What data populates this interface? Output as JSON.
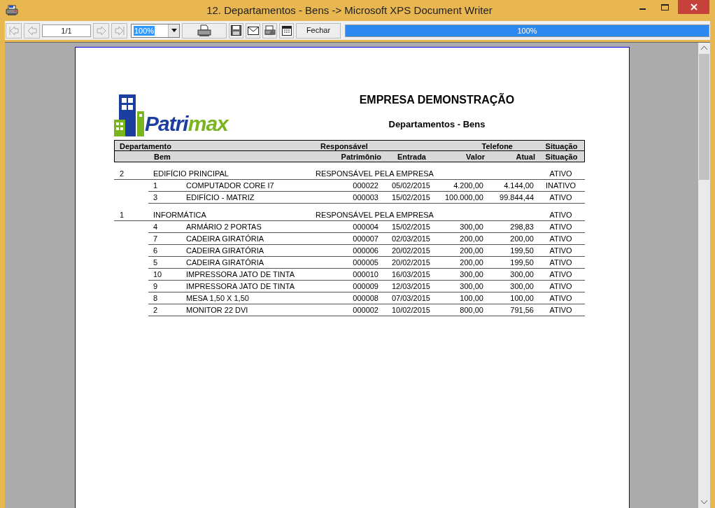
{
  "window": {
    "title": "12. Departamentos - Bens -> Microsoft XPS Document Writer"
  },
  "toolbar": {
    "page_field": "1/1",
    "zoom_value": "100%",
    "close_button": "Fechar",
    "progress": {
      "level": 1,
      "reading": "100%"
    }
  },
  "report": {
    "logo_text": [
      "Patri",
      "max"
    ],
    "company": "EMPRESA DEMONSTRAÇÃO",
    "title": "Departamentos - Bens",
    "header_row_1": [
      "Departamento",
      "Responsável",
      "Telefone",
      "Situação"
    ],
    "header_row_2": [
      "Bem",
      "Patrimônio",
      "Entrada",
      "Valor",
      "Atual",
      "Situação"
    ],
    "departments": [
      {
        "code": "2",
        "name": "EDIFÍCIO PRINCIPAL",
        "responsible": "RESPONSÁVEL PELA EMPRESA",
        "status": "ATIVO",
        "items": [
          {
            "code": "1",
            "name": "COMPUTADOR CORE I7",
            "asset": "000022",
            "date": "05/02/2015",
            "value": "4.200,00",
            "current": "4.144,00",
            "status": "INATIVO"
          },
          {
            "code": "3",
            "name": "EDIFÍCIO - MATRIZ",
            "asset": "000003",
            "date": "15/02/2015",
            "value": "100.000,00",
            "current": "99.844,44",
            "status": "ATIVO"
          }
        ]
      },
      {
        "code": "1",
        "name": "INFORMÁTICA",
        "responsible": "RESPONSÁVEL PELA EMPRESA",
        "status": "ATIVO",
        "items": [
          {
            "code": "4",
            "name": "ARMÁRIO 2 PORTAS",
            "asset": "000004",
            "date": "15/02/2015",
            "value": "300,00",
            "current": "298,83",
            "status": "ATIVO"
          },
          {
            "code": "7",
            "name": "CADEIRA GIRATÓRIA",
            "asset": "000007",
            "date": "02/03/2015",
            "value": "200,00",
            "current": "200,00",
            "status": "ATIVO"
          },
          {
            "code": "6",
            "name": "CADEIRA GIRATÓRIA",
            "asset": "000006",
            "date": "20/02/2015",
            "value": "200,00",
            "current": "199,50",
            "status": "ATIVO"
          },
          {
            "code": "5",
            "name": "CADEIRA GIRATÓRIA",
            "asset": "000005",
            "date": "20/02/2015",
            "value": "200,00",
            "current": "199,50",
            "status": "ATIVO"
          },
          {
            "code": "10",
            "name": "IMPRESSORA JATO DE TINTA",
            "asset": "000010",
            "date": "16/03/2015",
            "value": "300,00",
            "current": "300,00",
            "status": "ATIVO"
          },
          {
            "code": "9",
            "name": "IMPRESSORA JATO DE TINTA",
            "asset": "000009",
            "date": "12/03/2015",
            "value": "300,00",
            "current": "300,00",
            "status": "ATIVO"
          },
          {
            "code": "8",
            "name": "MESA 1,50 X 1,50",
            "asset": "000008",
            "date": "07/03/2015",
            "value": "100,00",
            "current": "100,00",
            "status": "ATIVO"
          },
          {
            "code": "2",
            "name": "MONITOR 22 DVI",
            "asset": "000002",
            "date": "10/02/2015",
            "value": "800,00",
            "current": "791,56",
            "status": "ATIVO"
          }
        ]
      }
    ]
  }
}
